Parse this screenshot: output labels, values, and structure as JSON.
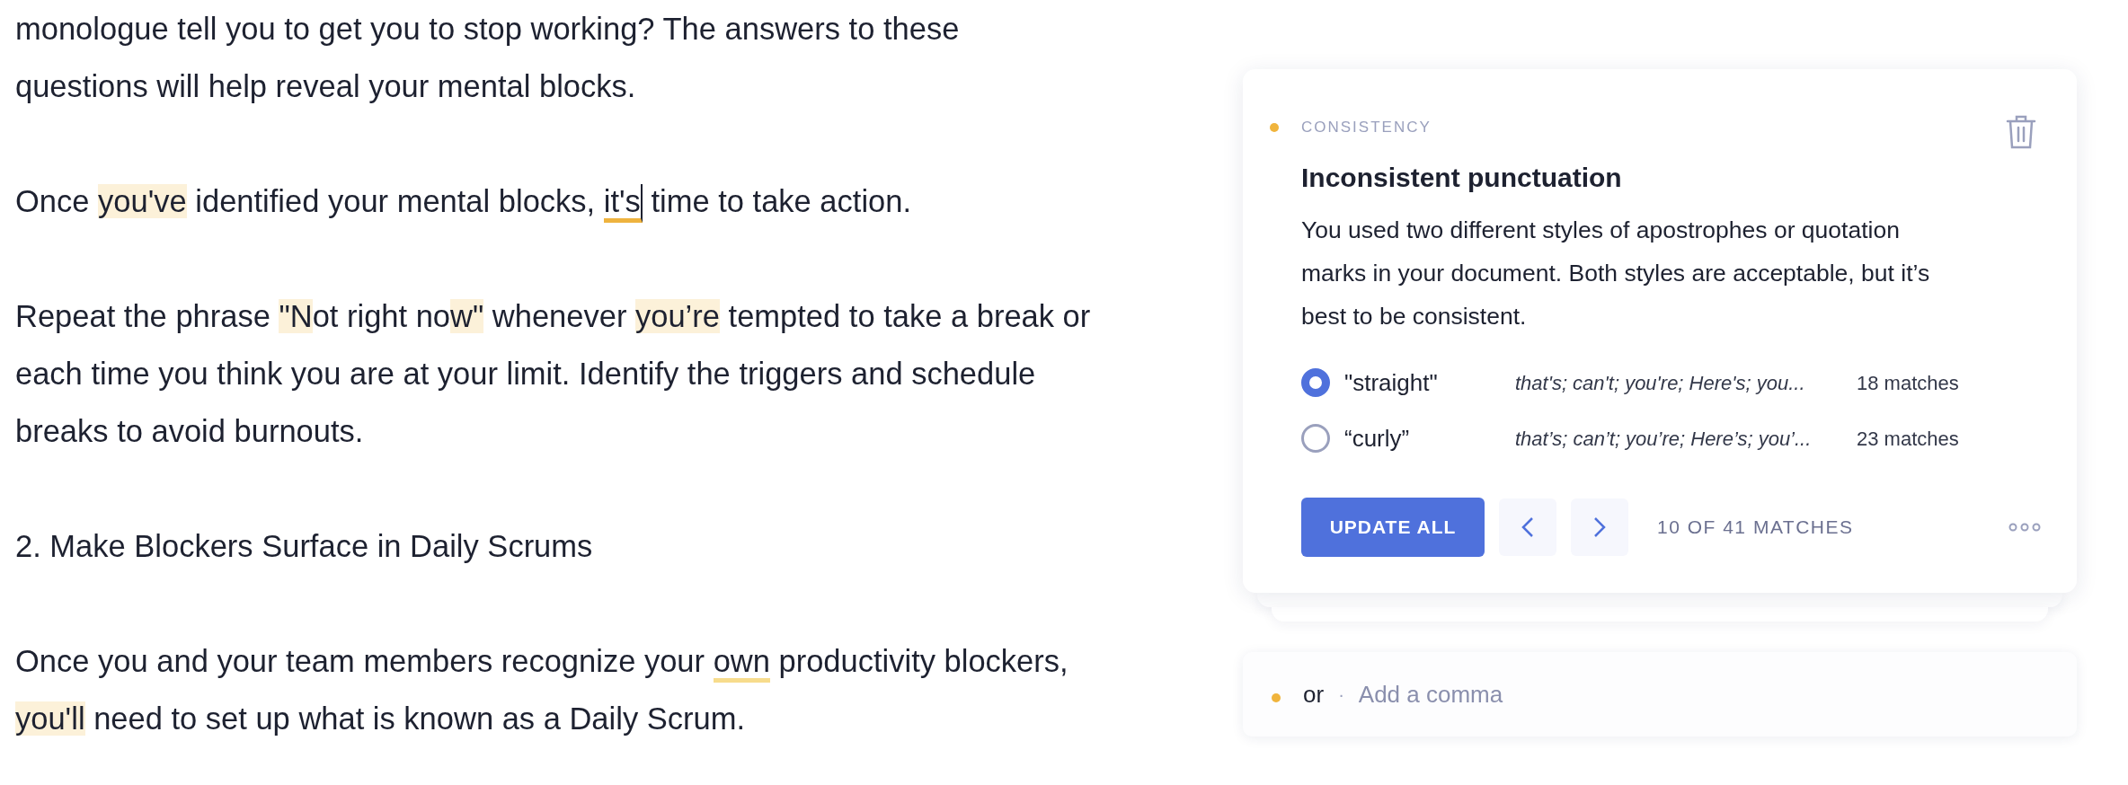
{
  "document": {
    "paragraphs": [
      {
        "segments": [
          {
            "text": "monologue tell you to get you to stop working? The answers to these questions will help reveal your mental blocks.",
            "kind": "plain"
          }
        ]
      },
      {
        "segments": [
          {
            "text": "Once ",
            "kind": "plain"
          },
          {
            "text": "you've",
            "kind": "highlight"
          },
          {
            "text": " identified your mental blocks, ",
            "kind": "plain"
          },
          {
            "text": "it's",
            "kind": "active",
            "caret": true
          },
          {
            "text": " time to take action.",
            "kind": "plain"
          }
        ]
      },
      {
        "segments": [
          {
            "text": "Repeat the phrase ",
            "kind": "plain"
          },
          {
            "text": "\"N",
            "kind": "highlight"
          },
          {
            "text": "ot right no",
            "kind": "plain"
          },
          {
            "text": "w\"",
            "kind": "highlight"
          },
          {
            "text": " whenever ",
            "kind": "plain"
          },
          {
            "text": "you’re",
            "kind": "highlight"
          },
          {
            "text": " tempted to take a break or each time you think you are at your limit. Identify the triggers and schedule breaks to avoid burnouts.",
            "kind": "plain"
          }
        ]
      },
      {
        "segments": [
          {
            "text": "2. Make Blockers Surface in Daily Scrums",
            "kind": "plain"
          }
        ]
      },
      {
        "segments": [
          {
            "text": "Once you and your team members recognize your ",
            "kind": "plain"
          },
          {
            "text": "own",
            "kind": "underline"
          },
          {
            "text": " productivity blockers, ",
            "kind": "plain"
          },
          {
            "text": "you'll",
            "kind": "highlight"
          },
          {
            "text": " need to set up what is known as a Daily Scrum.",
            "kind": "plain"
          }
        ]
      }
    ]
  },
  "suggestion_card": {
    "category": "CONSISTENCY",
    "title": "Inconsistent punctuation",
    "description": "You used two different styles of apostrophes or quotation marks in your document. Both styles are acceptable, but it’s best to be consistent.",
    "options": [
      {
        "label": "\"straight\"",
        "examples": "that's; can't; you're; Here's; you...",
        "count": "18 matches",
        "selected": true
      },
      {
        "label": "“curly”",
        "examples": "that’s; can’t; you’re; Here’s; you’...",
        "count": "23 matches",
        "selected": false
      }
    ],
    "update_button": "UPDATE ALL",
    "counter": "10 OF 41 MATCHES"
  },
  "next_card": {
    "word": "or",
    "separator": "·",
    "suggestion": "Add a comma"
  }
}
